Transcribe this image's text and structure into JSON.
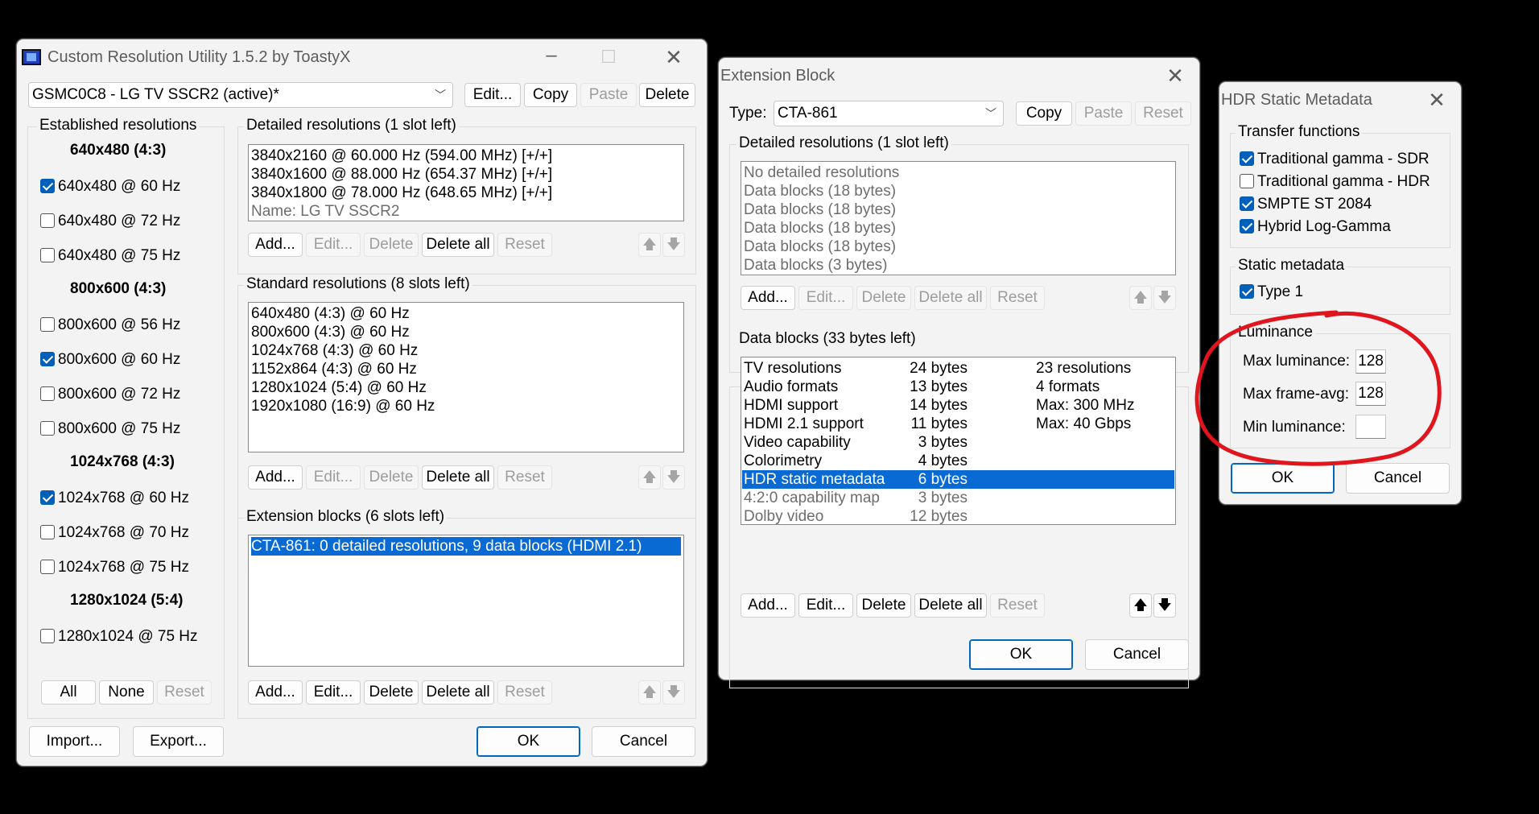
{
  "cru": {
    "title": "Custom Resolution Utility 1.5.2 by ToastyX",
    "monitor": "GSMC0C8 - LG TV SSCR2 (active)*",
    "top_buttons": {
      "edit": "Edit...",
      "copy": "Copy",
      "paste": "Paste",
      "delete": "Delete"
    },
    "established": {
      "label": "Established resolutions",
      "groups": [
        {
          "header": "640x480 (4:3)",
          "items": [
            {
              "label": "640x480 @ 60 Hz",
              "checked": true
            },
            {
              "label": "640x480 @ 72 Hz",
              "checked": false
            },
            {
              "label": "640x480 @ 75 Hz",
              "checked": false
            }
          ]
        },
        {
          "header": "800x600 (4:3)",
          "items": [
            {
              "label": "800x600 @ 56 Hz",
              "checked": false
            },
            {
              "label": "800x600 @ 60 Hz",
              "checked": true
            },
            {
              "label": "800x600 @ 72 Hz",
              "checked": false
            },
            {
              "label": "800x600 @ 75 Hz",
              "checked": false
            }
          ]
        },
        {
          "header": "1024x768 (4:3)",
          "items": [
            {
              "label": "1024x768 @ 60 Hz",
              "checked": true
            },
            {
              "label": "1024x768 @ 70 Hz",
              "checked": false
            },
            {
              "label": "1024x768 @ 75 Hz",
              "checked": false
            }
          ]
        },
        {
          "header": "1280x1024 (5:4)",
          "items": [
            {
              "label": "1280x1024 @ 75 Hz",
              "checked": false
            }
          ]
        }
      ],
      "buttons": {
        "all": "All",
        "none": "None",
        "reset": "Reset"
      }
    },
    "detailed": {
      "label": "Detailed resolutions (1 slot left)",
      "items": [
        "3840x2160 @ 60.000 Hz (594.00 MHz) [+/+]",
        "3840x1600 @ 88.000 Hz (654.37 MHz) [+/+]",
        "3840x1800 @ 78.000 Hz (648.65 MHz) [+/+]"
      ],
      "name_line": "Name: LG TV SSCR2"
    },
    "standard": {
      "label": "Standard resolutions (8 slots left)",
      "items": [
        "640x480 (4:3) @ 60 Hz",
        "800x600 (4:3) @ 60 Hz",
        "1024x768 (4:3) @ 60 Hz",
        "1152x864 (4:3) @ 60 Hz",
        "1280x1024 (5:4) @ 60 Hz",
        "1920x1080 (16:9) @ 60 Hz"
      ]
    },
    "extension": {
      "label": "Extension blocks (6 slots left)",
      "items": [
        "CTA-861: 0 detailed resolutions, 9 data blocks (HDMI 2.1)"
      ]
    },
    "list_buttons": {
      "add": "Add...",
      "edit": "Edit...",
      "delete": "Delete",
      "delete_all": "Delete all",
      "reset": "Reset"
    },
    "arrows": {
      "up": "🡅",
      "down": "🡇"
    },
    "bottom": {
      "import": "Import...",
      "export": "Export...",
      "ok": "OK",
      "cancel": "Cancel"
    }
  },
  "ext": {
    "title": "Extension Block",
    "type_label": "Type:",
    "type_value": "CTA-861",
    "top_buttons": {
      "copy": "Copy",
      "paste": "Paste",
      "reset": "Reset"
    },
    "detailed": {
      "label": "Detailed resolutions (1 slot left)",
      "items": [
        "No detailed resolutions",
        "Data blocks (18 bytes)",
        "Data blocks (18 bytes)",
        "Data blocks (18 bytes)",
        "Data blocks (18 bytes)",
        "Data blocks (3 bytes)"
      ]
    },
    "datablocks": {
      "label": "Data blocks (33 bytes left)",
      "rows": [
        {
          "name": "TV resolutions",
          "size": "24 bytes",
          "info": "23 resolutions"
        },
        {
          "name": "Audio formats",
          "size": "13 bytes",
          "info": "4 formats"
        },
        {
          "name": "HDMI support",
          "size": "14 bytes",
          "info": "Max: 300 MHz"
        },
        {
          "name": "HDMI 2.1 support",
          "size": "11 bytes",
          "info": "Max: 40 Gbps"
        },
        {
          "name": "Video capability",
          "size": "3 bytes",
          "info": ""
        },
        {
          "name": "Colorimetry",
          "size": "4 bytes",
          "info": ""
        },
        {
          "name": "HDR static metadata",
          "size": "6 bytes",
          "info": ""
        },
        {
          "name": "4:2:0 capability map",
          "size": "3 bytes",
          "info": ""
        },
        {
          "name": "Dolby video",
          "size": "12 bytes",
          "info": ""
        }
      ]
    },
    "bottom": {
      "ok": "OK",
      "cancel": "Cancel"
    }
  },
  "hdr": {
    "title": "HDR Static Metadata",
    "transfer": {
      "label": "Transfer functions",
      "items": [
        {
          "label": "Traditional gamma - SDR",
          "checked": true
        },
        {
          "label": "Traditional gamma - HDR",
          "checked": false
        },
        {
          "label": "SMPTE ST 2084",
          "checked": true
        },
        {
          "label": "Hybrid Log-Gamma",
          "checked": true
        }
      ]
    },
    "static": {
      "label": "Static metadata",
      "items": [
        {
          "label": "Type 1",
          "checked": true
        }
      ]
    },
    "luminance": {
      "label": "Luminance",
      "max_label": "Max luminance:",
      "max_value": "128",
      "avg_label": "Max frame-avg:",
      "avg_value": "128",
      "min_label": "Min luminance:",
      "min_value": ""
    },
    "bottom": {
      "ok": "OK",
      "cancel": "Cancel"
    }
  },
  "annotation_color": "#e0151d"
}
